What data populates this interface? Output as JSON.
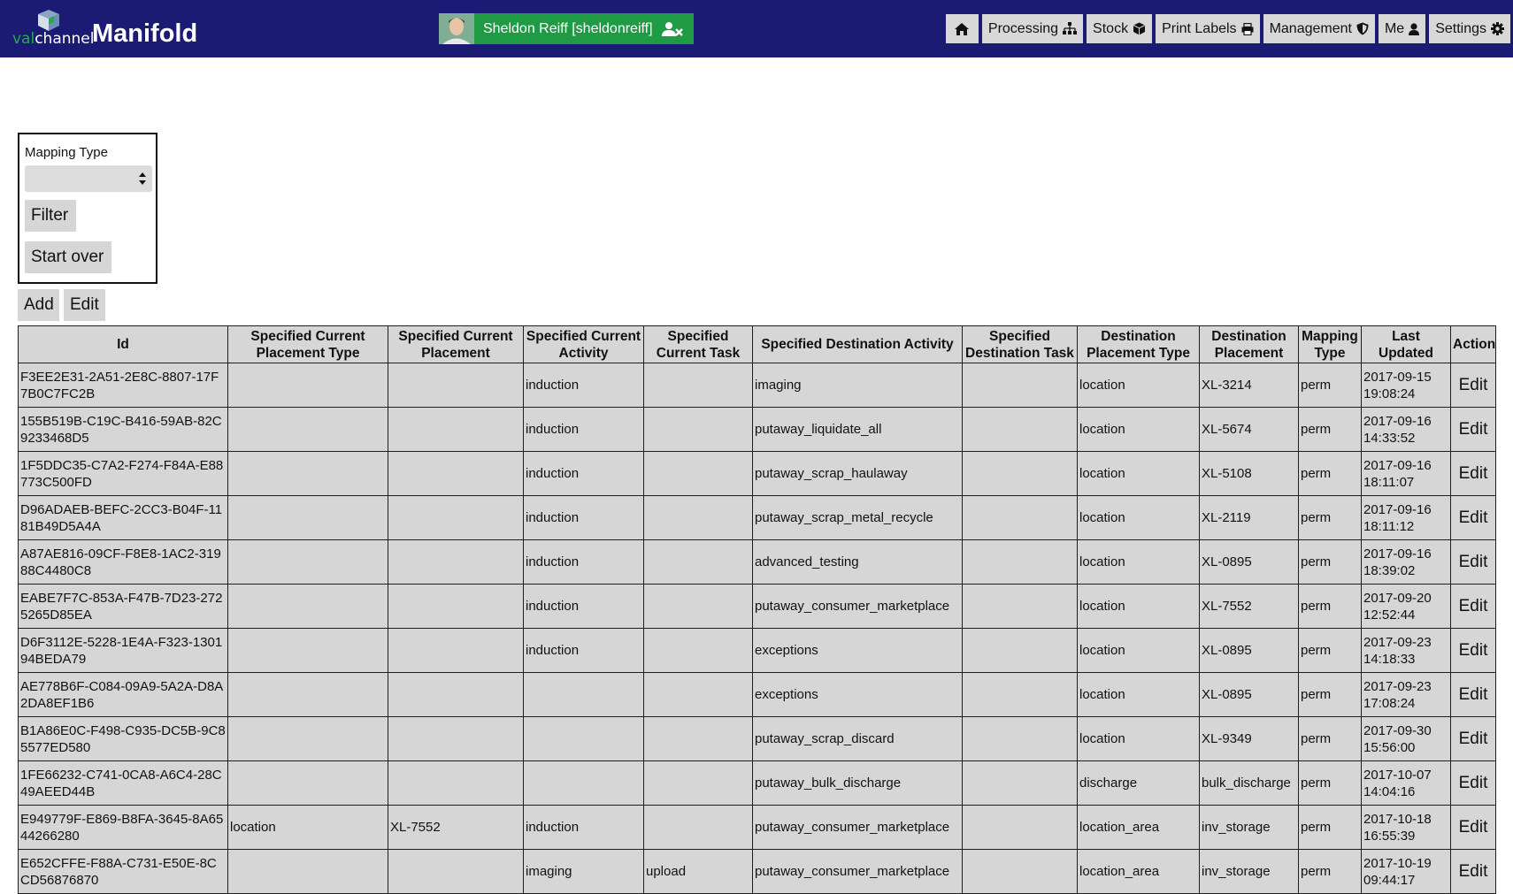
{
  "header": {
    "logo_small_green": "val",
    "logo_small_rest": "channel",
    "logo_big": "Manifold",
    "user_name": "Sheldon Reiff [sheldonreiff]",
    "icons": {
      "logo": "cube-logo-icon",
      "user": "avatar",
      "logout": "user-times-icon"
    },
    "nav": [
      {
        "label": "",
        "icon": "home-icon"
      },
      {
        "label": "Processing",
        "icon": "sitemap-icon"
      },
      {
        "label": "Stock",
        "icon": "cube-icon"
      },
      {
        "label": "Print Labels",
        "icon": "print-icon"
      },
      {
        "label": "Management",
        "icon": "shield-icon"
      },
      {
        "label": "Me",
        "icon": "user-icon"
      },
      {
        "label": "Settings",
        "icon": "gear-icon"
      }
    ]
  },
  "filter": {
    "label": "Mapping Type",
    "selected_value": "",
    "filter_button": "Filter",
    "start_over_button": "Start over"
  },
  "toolbar": {
    "add_label": "Add",
    "edit_label": "Edit"
  },
  "table": {
    "columns": [
      "Id",
      "Specified Current Placement Type",
      "Specified Current Placement",
      "Specified Current Activity",
      "Specified Current Task",
      "Specified Destination Activity",
      "Specified Destination Task",
      "Destination Placement Type",
      "Destination Placement",
      "Mapping Type",
      "Last Updated",
      "Action"
    ],
    "rows": [
      [
        "F3EE2E31-2A51-2E8C-8807-17F7B0C7FC2B",
        "",
        "",
        "induction",
        "",
        "imaging",
        "",
        "location",
        "XL-3214",
        "perm",
        "2017-09-15 19:08:24",
        "Edit"
      ],
      [
        "155B519B-C19C-B416-59AB-82C9233468D5",
        "",
        "",
        "induction",
        "",
        "putaway_liquidate_all",
        "",
        "location",
        "XL-5674",
        "perm",
        "2017-09-16 14:33:52",
        "Edit"
      ],
      [
        "1F5DDC35-C7A2-F274-F84A-E88773C500FD",
        "",
        "",
        "induction",
        "",
        "putaway_scrap_haulaway",
        "",
        "location",
        "XL-5108",
        "perm",
        "2017-09-16 18:11:07",
        "Edit"
      ],
      [
        "D96ADAEB-BEFC-2CC3-B04F-1181B49D5A4A",
        "",
        "",
        "induction",
        "",
        "putaway_scrap_metal_recycle",
        "",
        "location",
        "XL-2119",
        "perm",
        "2017-09-16 18:11:12",
        "Edit"
      ],
      [
        "A87AE816-09CF-F8E8-1AC2-31988C4480C8",
        "",
        "",
        "induction",
        "",
        "advanced_testing",
        "",
        "location",
        "XL-0895",
        "perm",
        "2017-09-16 18:39:02",
        "Edit"
      ],
      [
        "EABE7F7C-853A-F47B-7D23-2725265D85EA",
        "",
        "",
        "induction",
        "",
        "putaway_consumer_marketplace",
        "",
        "location",
        "XL-7552",
        "perm",
        "2017-09-20 12:52:44",
        "Edit"
      ],
      [
        "D6F3112E-5228-1E4A-F323-130194BEDA79",
        "",
        "",
        "induction",
        "",
        "exceptions",
        "",
        "location",
        "XL-0895",
        "perm",
        "2017-09-23 14:18:33",
        "Edit"
      ],
      [
        "AE778B6F-C084-09A9-5A2A-D8A2DA8EF1B6",
        "",
        "",
        "",
        "",
        "exceptions",
        "",
        "location",
        "XL-0895",
        "perm",
        "2017-09-23 17:08:24",
        "Edit"
      ],
      [
        "B1A86E0C-F498-C935-DC5B-9C85577ED580",
        "",
        "",
        "",
        "",
        "putaway_scrap_discard",
        "",
        "location",
        "XL-9349",
        "perm",
        "2017-09-30 15:56:00",
        "Edit"
      ],
      [
        "1FE66232-C741-0CA8-A6C4-28C49AEED44B",
        "",
        "",
        "",
        "",
        "putaway_bulk_discharge",
        "",
        "discharge",
        "bulk_discharge",
        "perm",
        "2017-10-07 14:04:16",
        "Edit"
      ],
      [
        "E949779F-E869-B8FA-3645-8A6544266280",
        "location",
        "XL-7552",
        "induction",
        "",
        "putaway_consumer_marketplace",
        "",
        "location_area",
        "inv_storage",
        "perm",
        "2017-10-18 16:55:39",
        "Edit"
      ],
      [
        "E652CFFE-F88A-C731-E50E-8CCD56876870",
        "",
        "",
        "imaging",
        "upload",
        "putaway_consumer_marketplace",
        "",
        "location_area",
        "inv_storage",
        "perm",
        "2017-10-19 09:44:17",
        "Edit"
      ]
    ]
  }
}
